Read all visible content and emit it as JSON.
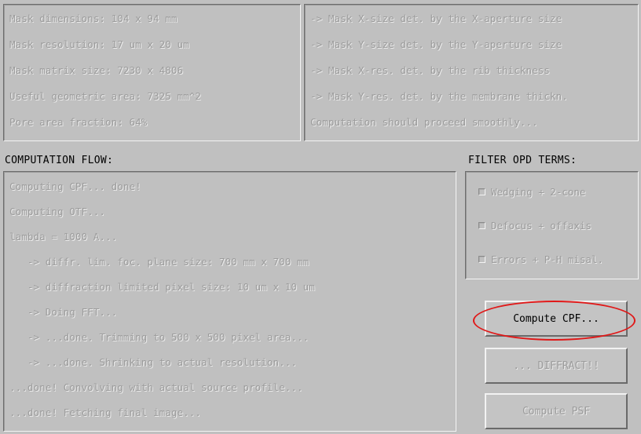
{
  "mask_info": {
    "lines": [
      "Mask dimensions: 104 x 94 mm",
      "Mask resolution: 17 um x 20 um",
      "Mask matrix size: 7230 x 4806",
      "Useful geometric area: 7325 mm^2",
      "Pore area fraction: 64%"
    ]
  },
  "mask_notes": {
    "lines": [
      "-> Mask X-size det. by the X-aperture size",
      "-> Mask Y-size det. by the Y-aperture size",
      "-> Mask X-res. det. by the rib thickness",
      "-> Mask Y-res. det. by the membrane thickn.",
      "Computation should proceed smoothly..."
    ]
  },
  "computation_flow": {
    "heading": "COMPUTATION FLOW:",
    "lines": [
      "Computing CPF... done!",
      "Computing OTF...",
      "lambda = 1000 A...",
      "   -> diffr. lim. foc. plane size: 700 mm x 700 mm",
      "   -> diffraction limited pixel size: 10 um x 10 um",
      "   -> Doing FFT...",
      "   -> ...done. Trimming to 500 x 500 pixel area...",
      "   -> ...done. Shrinking to actual resolution...",
      "...done! Convolving with actual source profile...",
      "...done! Fetching final image..."
    ]
  },
  "filter": {
    "heading": "FILTER OPD TERMS:",
    "options": [
      {
        "label": "Wedging + 2-cone",
        "checked": false
      },
      {
        "label": "Defocus + offaxis",
        "checked": false
      },
      {
        "label": "Errors + P-H misal.",
        "checked": false
      }
    ]
  },
  "buttons": {
    "compute_cpf": "Compute CPF...",
    "diffract": "... DIFFRACT!!",
    "compute_psf": "Compute PSF"
  },
  "colors": {
    "background": "#c0c0c0",
    "disabled_text": "#9c9c9c",
    "highlight": "#e01818"
  }
}
